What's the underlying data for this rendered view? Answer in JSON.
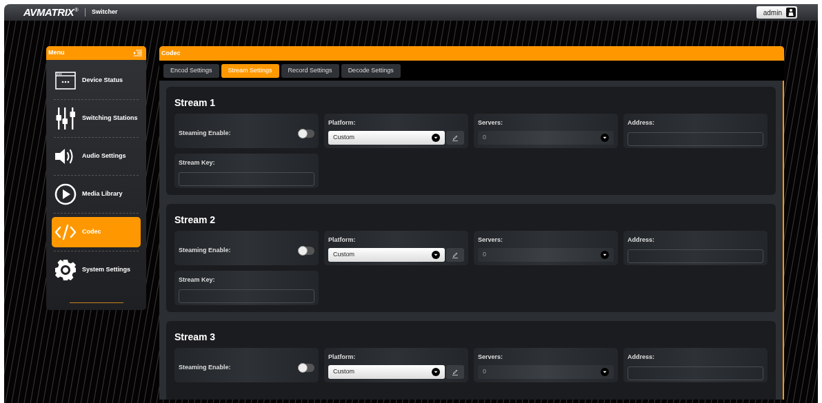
{
  "header": {
    "logo": "AVMATRIX",
    "registered": "®",
    "app": "Switcher",
    "user": "admin"
  },
  "menu": {
    "title": "Menu",
    "items": [
      {
        "kind": "device",
        "label": "Device Status",
        "selected": false
      },
      {
        "kind": "switching",
        "label": "Switching Stations",
        "selected": false
      },
      {
        "kind": "audio",
        "label": "Audio Settings",
        "selected": false
      },
      {
        "kind": "media",
        "label": "Media Library",
        "selected": false
      },
      {
        "kind": "codec",
        "label": "Codec",
        "selected": true
      },
      {
        "kind": "system",
        "label": "System Settings",
        "selected": false
      }
    ]
  },
  "panel": {
    "title": "Codec",
    "tabs": [
      {
        "label": "Encod Settings",
        "selected": false
      },
      {
        "label": "Stream Settings",
        "selected": true
      },
      {
        "label": "Record Settings",
        "selected": false
      },
      {
        "label": "Decode Settings",
        "selected": false
      }
    ],
    "streams": [
      {
        "title": "Stream 1",
        "enable_label": "Steaming Enable:",
        "on": false,
        "platform_label": "Platform:",
        "platform": "Custom",
        "servers_label": "Servers:",
        "servers": "0",
        "servers_disabled": true,
        "address_label": "Address:",
        "stream_key_label": "Stream Key:"
      },
      {
        "title": "Stream 2",
        "enable_label": "Steaming Enable:",
        "on": false,
        "platform_label": "Platform:",
        "platform": "Custom",
        "servers_label": "Servers:",
        "servers": "0",
        "servers_disabled": true,
        "address_label": "Address:",
        "stream_key_label": "Stream Key:"
      },
      {
        "title": "Stream 3",
        "enable_label": "Steaming Enable:",
        "on": false,
        "platform_label": "Platform:",
        "platform": "Custom",
        "servers_label": "Servers:",
        "servers": "0",
        "servers_disabled": true,
        "address_label": "Address:"
      }
    ]
  }
}
